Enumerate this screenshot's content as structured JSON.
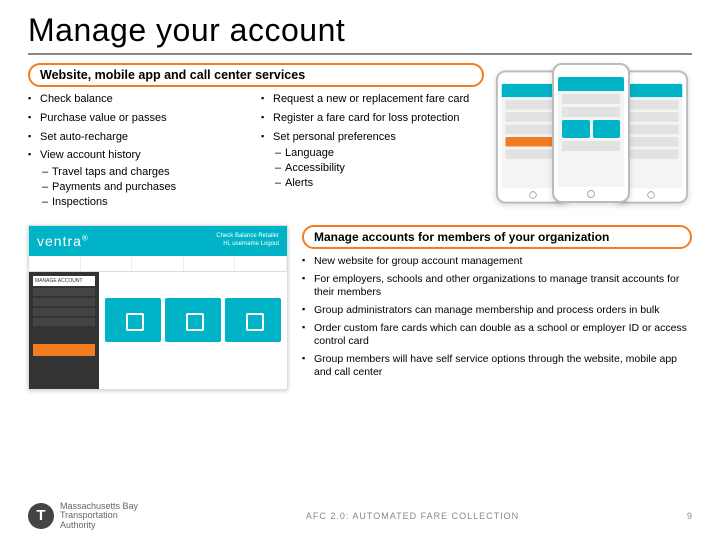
{
  "title": "Manage your account",
  "banner_top": "Website, mobile app and call center services",
  "col_left": [
    {
      "text": "Check balance"
    },
    {
      "text": "Purchase value or passes"
    },
    {
      "text": "Set auto-recharge"
    },
    {
      "text": "View account history",
      "sub": [
        "Travel taps and charges",
        "Payments and purchases",
        "Inspections"
      ]
    }
  ],
  "col_right": [
    {
      "text": "Request a new or replacement fare card"
    },
    {
      "text": "Register a fare card for loss protection"
    },
    {
      "text": "Set personal preferences",
      "sub": [
        "Language",
        "Accessibility",
        "Alerts"
      ]
    }
  ],
  "webshot": {
    "brand": "ventra",
    "brand_sup": "®",
    "meta1": "Check Balance   Retailer",
    "meta2": "Hi, username   Logout",
    "side_head": "MANAGE ACCOUNT"
  },
  "banner_bottom": "Manage accounts for members of your organization",
  "org_items": [
    "New website for group account management",
    "For employers, schools and other organizations to manage transit accounts for their members",
    "Group administrators can manage membership and process orders in bulk",
    "Order custom fare cards which can double as a school or employer ID or access control card",
    "Group members will have self service options through the website, mobile app and call center"
  ],
  "footer": {
    "logo_letter": "T",
    "org1": "Massachusetts Bay",
    "org2": "Transportation",
    "org3": "Authority",
    "center": "AFC 2.0:  AUTOMATED FARE COLLECTION",
    "page": "9"
  }
}
